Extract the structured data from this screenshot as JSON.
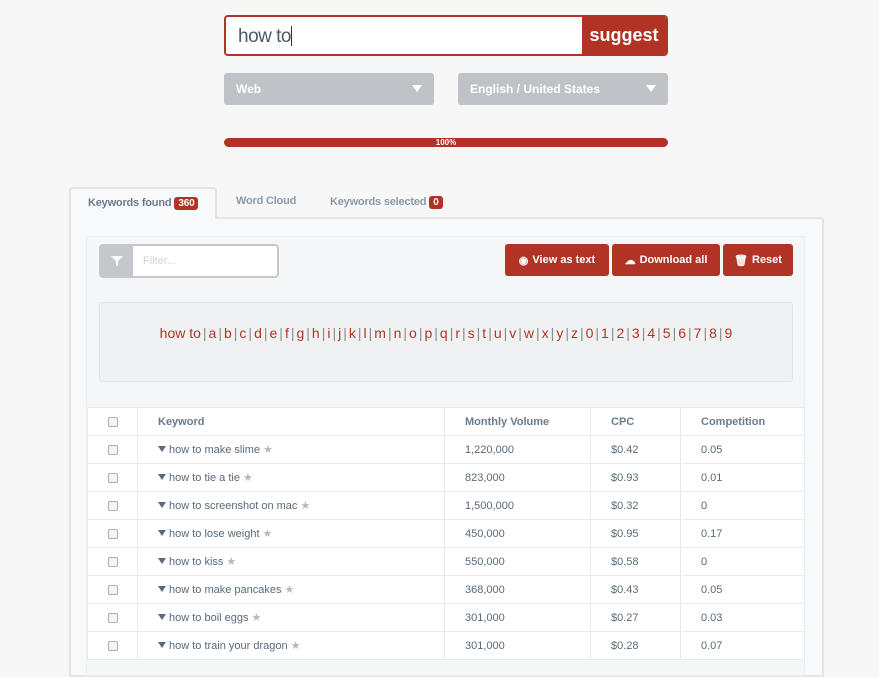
{
  "search": {
    "value": "how to",
    "button": "suggest"
  },
  "selects": {
    "source": "Web",
    "language": "English / United States"
  },
  "progress": {
    "percent": 100,
    "label": "100%"
  },
  "tabs": [
    {
      "label": "Keywords found",
      "count": "360"
    },
    {
      "label": "Word Cloud"
    },
    {
      "label": "Keywords selected",
      "count": "0"
    }
  ],
  "toolbar": {
    "filter_placeholder": "Filter...",
    "view_as_text": "View as text",
    "download_all": "Download all",
    "reset": "Reset"
  },
  "alphabet": [
    "how to",
    "a",
    "b",
    "c",
    "d",
    "e",
    "f",
    "g",
    "h",
    "i",
    "j",
    "k",
    "l",
    "m",
    "n",
    "o",
    "p",
    "q",
    "r",
    "s",
    "t",
    "u",
    "v",
    "w",
    "x",
    "y",
    "z",
    "0",
    "1",
    "2",
    "3",
    "4",
    "5",
    "6",
    "7",
    "8",
    "9"
  ],
  "table": {
    "headers": [
      "Keyword",
      "Monthly Volume",
      "CPC",
      "Competition"
    ],
    "rows": [
      [
        "how to make slime",
        "1,220,000",
        "$0.42",
        "0.05"
      ],
      [
        "how to tie a tie",
        "823,000",
        "$0.93",
        "0.01"
      ],
      [
        "how to screenshot on mac",
        "1,500,000",
        "$0.32",
        "0"
      ],
      [
        "how to lose weight",
        "450,000",
        "$0.95",
        "0.17"
      ],
      [
        "how to kiss",
        "550,000",
        "$0.58",
        "0"
      ],
      [
        "how to make pancakes",
        "368,000",
        "$0.43",
        "0.05"
      ],
      [
        "how to boil eggs",
        "301,000",
        "$0.27",
        "0.03"
      ],
      [
        "how to train your dragon",
        "301,000",
        "$0.28",
        "0.07"
      ]
    ]
  },
  "colors": {
    "accent": "#b03326",
    "select_bg": "#bfc3c7"
  },
  "icons": {
    "filter": "filter-icon",
    "view": "eye-icon",
    "download": "cloud-download-icon",
    "reset": "trash-icon",
    "row_expand": "caret-down-icon",
    "row_star": "star-icon"
  }
}
